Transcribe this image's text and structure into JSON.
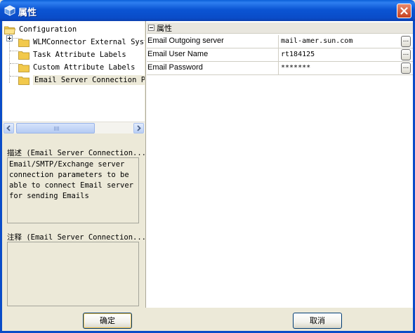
{
  "window": {
    "title": "属性",
    "close_icon": "close-icon"
  },
  "tree": {
    "root": {
      "label": "Configuration"
    },
    "items": [
      {
        "label": "WLMConnector External Syst",
        "expandable": true
      },
      {
        "label": "Task Attribute Labels"
      },
      {
        "label": "Custom Attribute Labels"
      },
      {
        "label": "Email Server Connection Pa",
        "selected": true
      }
    ]
  },
  "description": {
    "label": "描述 (Email Server Connection...",
    "text": "Email/SMTP/Exchange server\nconnection parameters to be\nable to connect Email server\nfor sending Emails"
  },
  "comment": {
    "label": "注释 (Email Server Connection...",
    "text": ""
  },
  "properties": {
    "category": "属性",
    "rows": [
      {
        "name": "Email Outgoing server",
        "value": "mail-amer.sun.com",
        "button": "..."
      },
      {
        "name": "Email User Name",
        "value": "rt184125",
        "button": "..."
      },
      {
        "name": "Email Password",
        "value": "*******",
        "button": "..."
      }
    ]
  },
  "buttons": {
    "ok": "确定",
    "cancel": "取消"
  },
  "colors": {
    "titlebar": "#0A4CC8",
    "window_bg": "#ECE9D8",
    "folder": "#F2C94C"
  }
}
